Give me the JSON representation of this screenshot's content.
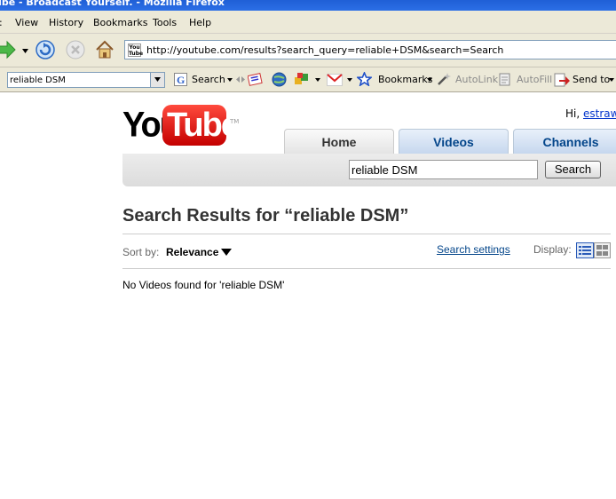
{
  "window": {
    "title": "ube - Broadcast Yourself. - Mozilla Firefox"
  },
  "menu": {
    "items": [
      {
        "label": "View"
      },
      {
        "label": "History"
      },
      {
        "label": "Bookmarks"
      },
      {
        "label": "Tools"
      },
      {
        "label": "Help"
      }
    ]
  },
  "navigation": {
    "url": "http://youtube.com/results?search_query=reliable+DSM&search=Search",
    "favicon_text": "You Tube"
  },
  "google_toolbar": {
    "query": "reliable DSM",
    "search_label": "Search",
    "bookmarks_label": "Bookmarks",
    "autolink_label": "AutoLink",
    "autofill_label": "AutoFill",
    "sendto_label": "Send to"
  },
  "page": {
    "logo": {
      "you": "You",
      "tube": "Tube",
      "tm": "TM"
    },
    "greeting": {
      "prefix": "Hi, ",
      "username": "estraw!"
    },
    "tabs": [
      {
        "label": "Home",
        "active": true
      },
      {
        "label": "Videos",
        "active": false
      },
      {
        "label": "Channels",
        "active": false
      }
    ],
    "search": {
      "value": "reliable DSM",
      "button_label": "Search"
    },
    "results_title": "Search Results for “reliable DSM”",
    "sort": {
      "label": "Sort by:",
      "value": "Relevance"
    },
    "search_settings_label": "Search settings",
    "display_label": "Display:",
    "no_results_text": "No Videos found for 'reliable DSM'"
  },
  "colors": {
    "youtube_red": "#e62117",
    "link_blue": "#03458a",
    "tab_blue": "#c6d7ee"
  }
}
